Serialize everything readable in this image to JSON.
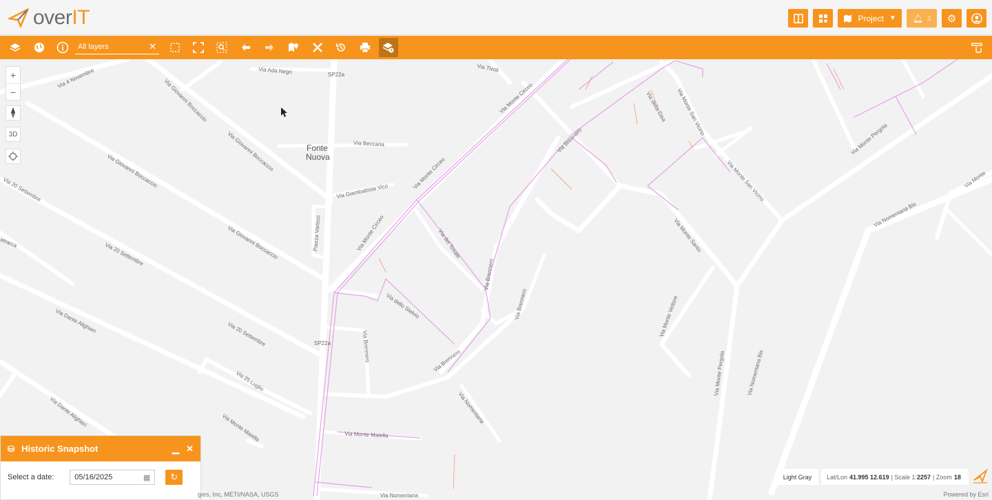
{
  "header": {
    "logo_text": "over",
    "logo_text_accent": "IT",
    "project_label": "Project",
    "notification_count": "3"
  },
  "toolbar": {
    "layer_filter": "All layers",
    "clear_icon": "✕"
  },
  "map": {
    "place_name_line1": "Fonte",
    "place_name_line2": "Nuova",
    "zoom_in": "+",
    "zoom_out": "−",
    "view_3d": "3D",
    "streets": [
      "Via Ada Negri",
      "SP22a",
      "Via Tivoli",
      "Via 4 Novembre",
      "Via Giovanni Boccaccio",
      "Via Giovanni Boccaccio",
      "Via Beccaria",
      "Via Giovanni Boccaccio",
      "Via Giambattista Vico",
      "Via 20 Settembre",
      "Piazza Varisco",
      "Via Monte Circeo",
      "Via Monte Circeo",
      "Via Monte Circeo",
      "Via Giovanni Boccaccio",
      "Via 20 Settembre",
      "Via del Tosale",
      "Via Brennero",
      "Via Brennero",
      "Via dello Stelvio",
      "Via Brennero",
      "Via Dante Alighieri",
      "Via 20 Settembre",
      "SP22a",
      "Via Brennero",
      "Via Brennero",
      "Via Nomentana",
      "Via 25 Luglio",
      "Via Dante Alighieri",
      "Via Monte Maiella",
      "Via della Cisa",
      "Via Monte San Vicino",
      "Via Monte San Vicino",
      "Via Monte Santo",
      "Via Monte Vettore",
      "Via Monte Pergola",
      "Via Monte Pergola",
      "Via Nomentana Bis",
      "Via Nomentana Bis",
      "Via Nomentana",
      "etrarca",
      "Via Monte"
    ]
  },
  "panel": {
    "title": "Historic Snapshot",
    "date_label": "Select a date:",
    "date_value": "05/16/2025"
  },
  "status": {
    "basemap": "Light Gray",
    "latlon_label": "Lat/Lon",
    "latlon_value": "41.995 12.619",
    "scale_label": "| Scale 1:",
    "scale_value": "2257",
    "zoom_label": "| Zoom",
    "zoom_value": "18",
    "attribution": "gies, Inc, METI/NASA, USGS",
    "powered": "Powered by Esri"
  },
  "colors": {
    "accent": "#f7941d",
    "road": "#ffffff",
    "network_pink": "#e5a0e5",
    "network_orange": "#f4a98a"
  }
}
